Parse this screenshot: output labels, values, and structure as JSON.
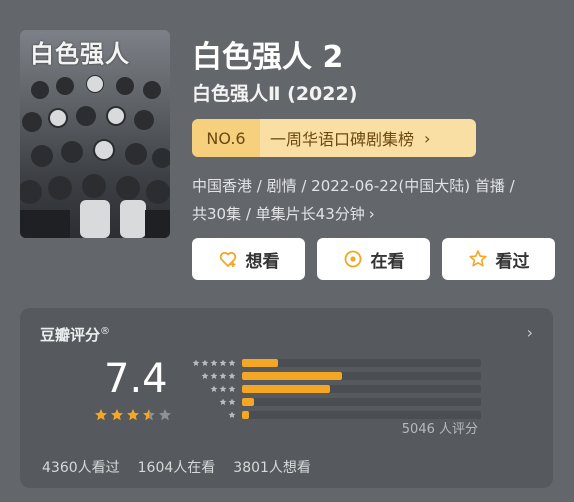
{
  "poster": {
    "title_text": "白色强人",
    "alt": "poster"
  },
  "title": "白色强人 2",
  "subtitle": "白色强人Ⅱ (2022)",
  "rank": {
    "no": "NO.6",
    "text": "一周华语口碑剧集榜",
    "chevron": "›"
  },
  "meta": {
    "line1": "中国香港 / 剧情 / 2022-06-22(中国大陆) 首播 /",
    "line2": "共30集 / 单集片长43分钟",
    "chevron": "›"
  },
  "actions": [
    {
      "label": "想看",
      "icon": "heart-plus-icon"
    },
    {
      "label": "在看",
      "icon": "target-circle-icon"
    },
    {
      "label": "看过",
      "icon": "star-outline-icon"
    }
  ],
  "rating": {
    "label": "豆瓣评分",
    "registered_mark": "®",
    "chevron": "›",
    "score": "7.4",
    "stars_value": 3.5,
    "distribution": [
      {
        "stars": 5,
        "fraction": 0.15
      },
      {
        "stars": 4,
        "fraction": 0.42
      },
      {
        "stars": 3,
        "fraction": 0.37
      },
      {
        "stars": 2,
        "fraction": 0.05
      },
      {
        "stars": 1,
        "fraction": 0.03
      }
    ],
    "count": "5046 人评分",
    "stats": [
      "4360人看过",
      "1604人在看",
      "3801人想看"
    ]
  },
  "colors": {
    "background": "#63666b",
    "card": "#56595e",
    "accent_star": "#f5a623",
    "rank_no_bg": "#f6d07c",
    "rank_text_bg": "#f9dfa3"
  }
}
